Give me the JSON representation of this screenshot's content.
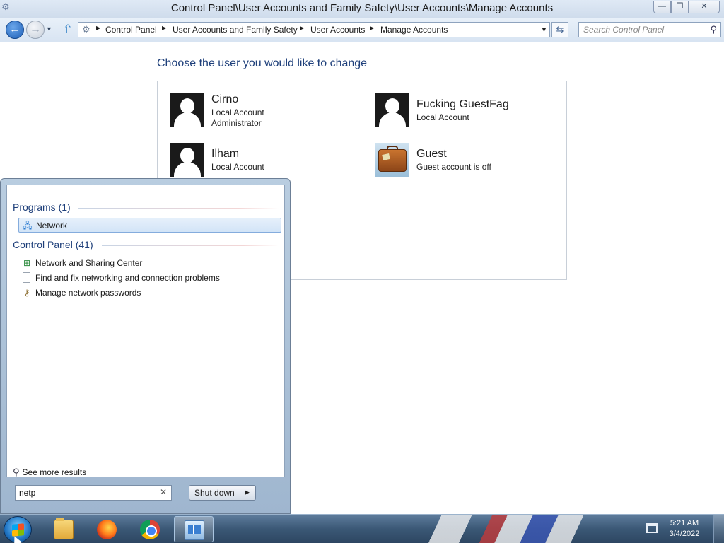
{
  "window": {
    "title": "Control Panel\\User Accounts and Family Safety\\User Accounts\\Manage Accounts",
    "controls": {
      "minimize": "—",
      "maximize": "❐",
      "close": "✕"
    }
  },
  "navbar": {
    "breadcrumbs": [
      "Control Panel",
      "User Accounts and Family Safety",
      "User Accounts",
      "Manage Accounts"
    ],
    "search_placeholder": "Search Control Panel"
  },
  "main": {
    "heading": "Choose the user you would like to change",
    "users": [
      {
        "name": "Cirno",
        "line1": "Local Account",
        "line2": "Administrator",
        "avatar": "silhouette-icon"
      },
      {
        "name": "Fucking GuestFag",
        "line1": "Local Account",
        "line2": "",
        "avatar": "silhouette-icon"
      },
      {
        "name": "Ilham",
        "line1": "Local Account",
        "line2": "",
        "avatar": "silhouette-icon"
      },
      {
        "name": "Guest",
        "line1": "Guest account is off",
        "line2": "",
        "avatar": "suitcase-icon"
      }
    ]
  },
  "start_menu": {
    "sections": [
      {
        "header": "Programs (1)",
        "items": [
          {
            "label": "Network",
            "icon": "network-icon",
            "selected": true
          }
        ]
      },
      {
        "header": "Control Panel (41)",
        "items": [
          {
            "label": "Network and Sharing Center",
            "icon": "sharing-center-icon"
          },
          {
            "label": "Find and fix networking and connection problems",
            "icon": "document-icon"
          },
          {
            "label": "Manage network passwords",
            "icon": "credential-icon"
          }
        ]
      }
    ],
    "see_more": "See more results",
    "search_value": "netp",
    "shutdown_label": "Shut down"
  },
  "taskbar": {
    "apps": [
      "file-explorer-icon",
      "firefox-icon",
      "chrome-icon",
      "control-panel-icon"
    ],
    "active_app": "control-panel-icon",
    "clock_time": "5:21 AM",
    "clock_date": "3/4/2022"
  }
}
